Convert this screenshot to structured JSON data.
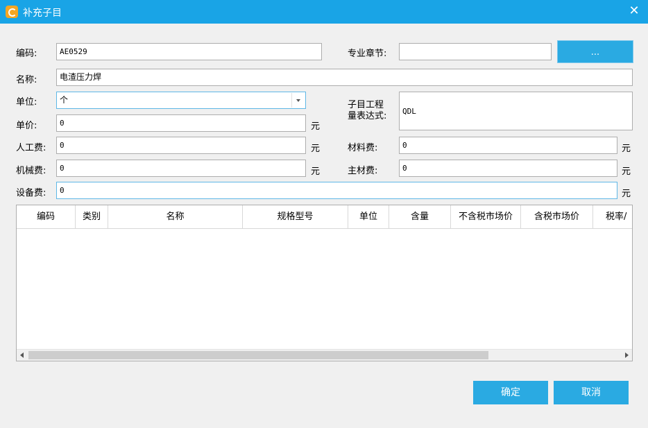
{
  "title": "补充子目",
  "colors": {
    "titlebar": "#19a4e6",
    "button": "#2aaae2"
  },
  "form": {
    "code_label": "编码:",
    "code_value": "AE0529",
    "chapter_label": "专业章节:",
    "chapter_value": "",
    "browse_label": "...",
    "name_label": "名称:",
    "name_value": "电渣压力焊",
    "unit_label": "单位:",
    "unit_value": "个",
    "expr_label_line1": "子目工程",
    "expr_label_line2": "量表达式:",
    "expr_value": "QDL",
    "price_label": "单价:",
    "price_value": "0",
    "labor_label": "人工费:",
    "labor_value": "0",
    "material_label": "材料费:",
    "material_value": "0",
    "machine_label": "机械费:",
    "machine_value": "0",
    "main_material_label": "主材费:",
    "main_material_value": "0",
    "equipment_label": "设备费:",
    "equipment_value": "0",
    "currency": "元"
  },
  "table": {
    "columns": [
      "编码",
      "类别",
      "名称",
      "规格型号",
      "单位",
      "含量",
      "不含税市场价",
      "含税市场价",
      "税率/"
    ]
  },
  "buttons": {
    "ok": "确定",
    "cancel": "取消"
  },
  "icons": {
    "app": "app-logo-icon",
    "close": "close-icon"
  }
}
